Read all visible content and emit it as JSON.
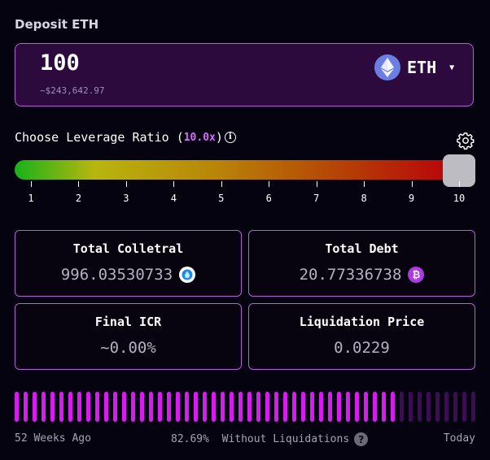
{
  "header": {
    "title": "Deposit ETH"
  },
  "deposit": {
    "amount": "100",
    "usd_value": "~$243,642.97",
    "token": "ETH",
    "token_icon": "ethereum-icon",
    "dropdown_icon": "caret-down-icon"
  },
  "leverage": {
    "label": "Choose Leverage Ratio",
    "open_paren": "(",
    "value": "10.0x",
    "close_paren": ")",
    "info_icon": "info-icon",
    "settings_icon": "gear-icon",
    "selected": 10,
    "min": 1,
    "max": 10,
    "ticks": [
      "1",
      "2",
      "3",
      "4",
      "5",
      "6",
      "7",
      "8",
      "9",
      "10"
    ]
  },
  "stats": {
    "total_collateral": {
      "label": "Total Colletral",
      "value": "996.03530733",
      "icon": "droplet-token-icon"
    },
    "total_debt": {
      "label": "Total Debt",
      "value": "20.77336738",
      "icon": "bitcoin-icon"
    },
    "final_icr": {
      "label": "Final ICR",
      "value": "~0.00%"
    },
    "liquidation_price": {
      "label": "Liquidation Price",
      "value": "0.0229"
    }
  },
  "history": {
    "total_weeks": 52,
    "active_weeks": 43,
    "start_label": "52 Weeks Ago",
    "percent": "82.69%",
    "description": "Without Liquidations",
    "help_icon": "question-icon",
    "end_label": "Today",
    "active_color": "#d81cf0",
    "inactive_color": "#3c0d52"
  },
  "colors": {
    "accent": "#d86bff",
    "border": "#b65fd6",
    "deposit_bg": "#2d0a3e",
    "page_bg": "#05030f"
  }
}
